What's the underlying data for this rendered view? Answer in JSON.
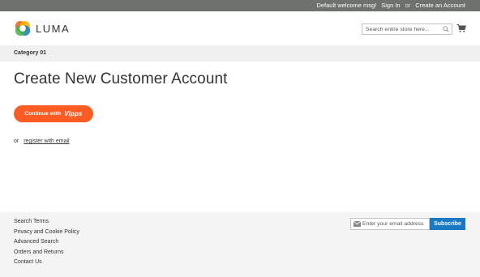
{
  "topbar": {
    "welcome": "Default welcome msg!",
    "sign_in": "Sign In",
    "or": "or",
    "create_account": "Create an Account"
  },
  "logo": {
    "text": "LUMA",
    "icon": "luma-logo-icon"
  },
  "search": {
    "placeholder": "Search entire store here...",
    "value": "",
    "icon": "search-icon"
  },
  "cart": {
    "icon": "cart-icon"
  },
  "breadcrumb": {
    "current": "Category 01"
  },
  "page": {
    "title": "Create New Customer Account",
    "vipps_button": {
      "prefix": "Continue with",
      "brand": "Vipps"
    },
    "register": {
      "or": "or",
      "link": "register with email"
    }
  },
  "footer": {
    "links": [
      "Search Terms",
      "Privacy and Cookie Policy",
      "Advanced Search",
      "Orders and Returns",
      "Contact Us"
    ],
    "newsletter": {
      "placeholder": "Enter your email address",
      "value": "",
      "button": "Subscribe",
      "icon": "mail-icon"
    }
  },
  "colors": {
    "topbar_bg": "#6e716e",
    "vipps_orange": "#ff5b24",
    "subscribe_blue": "#1979c3",
    "breadcrumb_bg": "#f0f0f0",
    "footer_bg": "#f4f4f4"
  }
}
